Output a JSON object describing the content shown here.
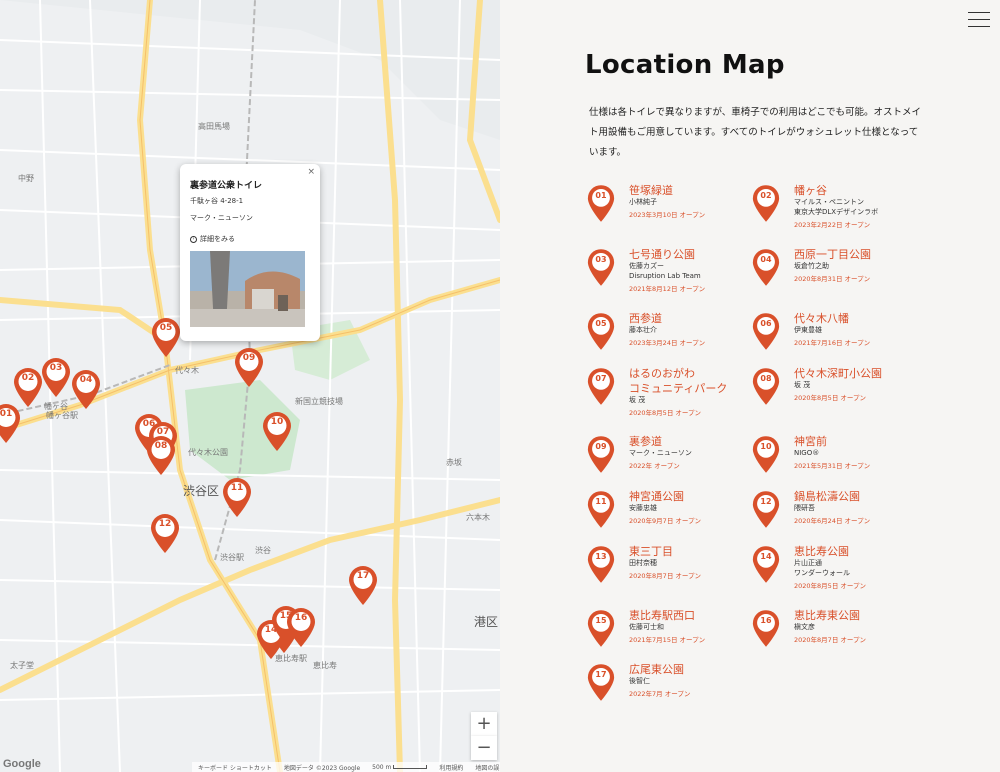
{
  "page": {
    "title": "Location Map",
    "description": "仕様は各トイレで異なりますが、車椅子での利用はどこでも可能。オストメイト用設備もご用意しています。すべてのトイレがウォシュレット仕様となっています。",
    "menu_icon": "hamburger-menu-icon"
  },
  "colors": {
    "accent": "#d9502a",
    "background": "#f6f5f3",
    "map_bg": "#eef0f2",
    "road": "#ffffff",
    "arterial": "#fbdf8f",
    "park": "#cde8cf"
  },
  "map": {
    "labels": {
      "hatagaya_station": "幡ヶ谷駅",
      "hatagaya": "幡ヶ谷",
      "nakano": "中野",
      "yoyogi": "代々木",
      "yoyogi_park": "代々木公園",
      "kokuritsu": "新国立競技場",
      "shibuya_ku": "渋谷区",
      "shibuya": "渋谷",
      "shibuya_station": "渋谷駅",
      "akasaka": "赤坂",
      "roppongi": "六本木",
      "minato_ku": "港区",
      "ebisu": "恵比寿",
      "ebisu_station": "恵比寿駅",
      "taishido": "太子堂",
      "koenji": "高田馬場"
    },
    "zoom_in": "+",
    "zoom_out": "−",
    "google_logo": "Google",
    "footer": {
      "shortcuts": "キーボード ショートカット",
      "map_data": "地図データ ©2023 Google",
      "scale": "500 m",
      "terms": "利用規約",
      "report": "地図の誤りを報告する"
    },
    "pins": [
      "01",
      "02",
      "03",
      "04",
      "05",
      "06",
      "07",
      "08",
      "09",
      "10",
      "11",
      "12",
      "13",
      "14",
      "15",
      "16",
      "17"
    ]
  },
  "popup": {
    "title": "裏参道公衆トイレ",
    "address": "千駄ヶ谷 4-28-1",
    "designer": "マーク・ニューソン",
    "more": "詳細をみる",
    "close": "×"
  },
  "locations": [
    {
      "num": "01",
      "name": "笹塚緑道",
      "designer": "小林純子",
      "date": "2023年3月10日 オープン"
    },
    {
      "num": "02",
      "name": "幡ヶ谷",
      "designer": "マイルス・ペニントン\n東京大学DLXデザインラボ",
      "date": "2023年2月22日 オープン"
    },
    {
      "num": "03",
      "name": "七号通り公園",
      "designer": "佐藤カズー\nDisruption Lab Team",
      "date": "2021年8月12日 オープン"
    },
    {
      "num": "04",
      "name": "西原一丁目公園",
      "designer": "坂倉竹之助",
      "date": "2020年8月31日 オープン"
    },
    {
      "num": "05",
      "name": "西参道",
      "designer": "藤本壮介",
      "date": "2023年3月24日 オープン"
    },
    {
      "num": "06",
      "name": "代々木八幡",
      "designer": "伊東豊雄",
      "date": "2021年7月16日 オープン"
    },
    {
      "num": "07",
      "name": "はるのおがわ\nコミュニティパーク",
      "designer": "坂 茂",
      "date": "2020年8月5日 オープン"
    },
    {
      "num": "08",
      "name": "代々木深町小公園",
      "designer": "坂 茂",
      "date": "2020年8月5日 オープン"
    },
    {
      "num": "09",
      "name": "裏参道",
      "designer": "マーク・ニューソン",
      "date": "2022年 オープン"
    },
    {
      "num": "10",
      "name": "神宮前",
      "designer": "NIGO®",
      "date": "2021年5月31日 オープン"
    },
    {
      "num": "11",
      "name": "神宮通公園",
      "designer": "安藤忠雄",
      "date": "2020年9月7日 オープン"
    },
    {
      "num": "12",
      "name": "鍋島松濤公園",
      "designer": "隈研吾",
      "date": "2020年6月24日 オープン"
    },
    {
      "num": "13",
      "name": "東三丁目",
      "designer": "田村奈穂",
      "date": "2020年8月7日 オープン"
    },
    {
      "num": "14",
      "name": "恵比寿公園",
      "designer": "片山正通\nワンダーウォール",
      "date": "2020年8月5日 オープン"
    },
    {
      "num": "15",
      "name": "恵比寿駅西口",
      "designer": "佐藤可士和",
      "date": "2021年7月15日 オープン"
    },
    {
      "num": "16",
      "name": "恵比寿東公園",
      "designer": "槇文彦",
      "date": "2020年8月7日 オープン"
    },
    {
      "num": "17",
      "name": "広尾東公園",
      "designer": "後智仁",
      "date": "2022年7月 オープン"
    }
  ]
}
